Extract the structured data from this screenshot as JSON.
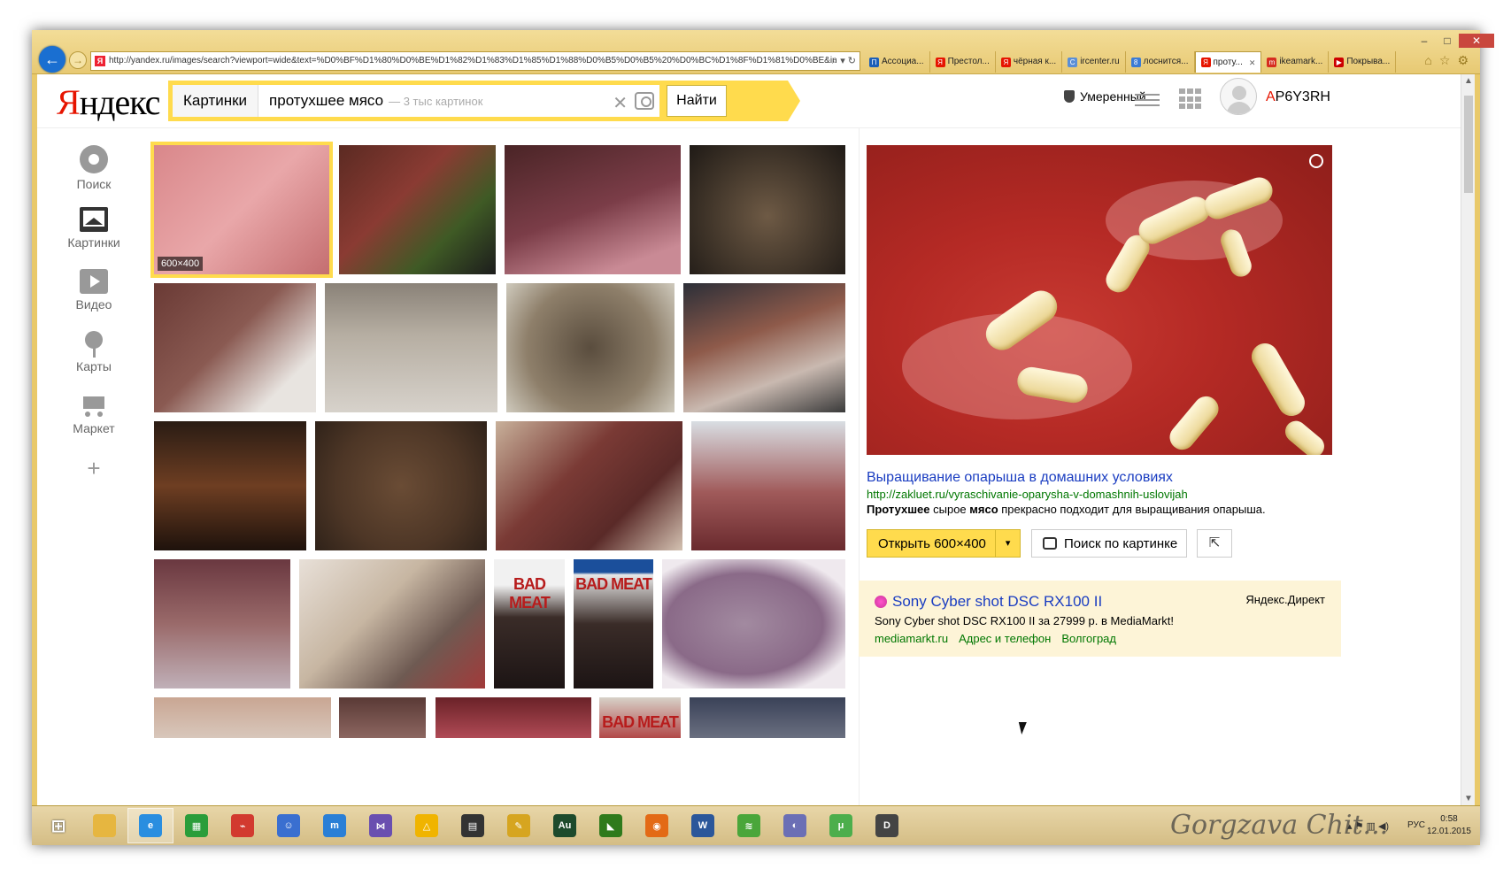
{
  "browser": {
    "address": "http://yandex.ru/images/search?viewport=wide&text=%D0%BF%D1%80%D0%BE%D1%82%D1%83%D1%85%D1%88%D0%B5%D0%B5%20%D0%BC%D1%8F%D1%81%D0%BE&in",
    "tabs": [
      {
        "label": "Ассоциа...",
        "color": "#1b5fb8",
        "glyph": "П"
      },
      {
        "label": "Престол...",
        "color": "#e61400",
        "glyph": "Я"
      },
      {
        "label": "чёрная к...",
        "color": "#e61400",
        "glyph": "Я"
      },
      {
        "label": "ircenter.ru",
        "color": "#5a8fd6",
        "glyph": "C"
      },
      {
        "label": "лоснится...",
        "color": "#3a7bd5",
        "glyph": "8"
      },
      {
        "label": "проту...",
        "color": "#e61400",
        "glyph": "Я",
        "active": true
      },
      {
        "label": "ikeamark...",
        "color": "#d62d20",
        "glyph": "m"
      },
      {
        "label": "Покрыва...",
        "color": "#cc0000",
        "glyph": "▶"
      }
    ],
    "window_buttons": {
      "minimize": "–",
      "maximize": "□",
      "close": "✕"
    }
  },
  "header": {
    "logo_first": "Я",
    "logo_rest": "ндекс",
    "search_tag": "Картинки",
    "search_query": "протухшее мясо",
    "search_count": "— 3 тыс картинок",
    "find_label": "Найти",
    "safe_search": "Умеренный",
    "username_first": "A",
    "username_rest": "P6Y3RH"
  },
  "services": [
    {
      "label": "Поиск",
      "icon": "search-icon",
      "kind": "search"
    },
    {
      "label": "Картинки",
      "icon": "picture-icon",
      "kind": "pic"
    },
    {
      "label": "Видео",
      "icon": "video-icon",
      "kind": "video"
    },
    {
      "label": "Карты",
      "icon": "map-pin-icon",
      "kind": "maps"
    },
    {
      "label": "Маркет",
      "icon": "cart-icon",
      "kind": "cart"
    }
  ],
  "selected_size": "600×400",
  "dvd_titles": [
    "BAD MEAT",
    "BAD MEAT",
    "BAD MEAT"
  ],
  "preview": {
    "title": "Выращивание опарыша в домашних условиях",
    "url": "http://zakluet.ru/vyraschivanie-oparysha-v-domashnih-uslovijah",
    "snippet_b1": "Протухшее",
    "snippet_t1": " сырое ",
    "snippet_b2": "мясо",
    "snippet_t2": " прекрасно подходит для выращивания опарыша.",
    "open_label": "Открыть 600×400",
    "reverse_label": "Поиск по картинке"
  },
  "direct": {
    "title": "Sony Cyber shot DSC RX100 II",
    "label": "Яндекс.Директ",
    "text": "Sony Cyber shot DSC RX100 II за 27999 р. в MediaMarkt!",
    "links": [
      "mediamarkt.ru",
      "Адрес и телефон",
      "Волгоград"
    ]
  },
  "taskbar": {
    "apps": [
      {
        "name": "windows-start-icon",
        "color": "#ffffff",
        "glyph": "⊞"
      },
      {
        "name": "file-explorer-icon",
        "color": "#e6b640",
        "glyph": ""
      },
      {
        "name": "internet-explorer-icon",
        "color": "#2a8ee0",
        "glyph": "e",
        "active": true
      },
      {
        "name": "store-icon",
        "color": "#2a9d3a",
        "glyph": "▦"
      },
      {
        "name": "usb-icon",
        "color": "#d23a2f",
        "glyph": "⌁"
      },
      {
        "name": "contacts-icon",
        "color": "#3a6fd0",
        "glyph": "☺"
      },
      {
        "name": "maxthon-icon",
        "color": "#2a7fd6",
        "glyph": "m"
      },
      {
        "name": "vs-icon",
        "color": "#6a4fb0",
        "glyph": "⋈"
      },
      {
        "name": "drive-icon",
        "color": "#f0b400",
        "glyph": "△"
      },
      {
        "name": "film-icon",
        "color": "#333333",
        "glyph": "▤"
      },
      {
        "name": "pen-icon",
        "color": "#d6a520",
        "glyph": "✎"
      },
      {
        "name": "audition-icon",
        "color": "#1d4a2c",
        "glyph": "Au"
      },
      {
        "name": "nvidia-icon",
        "color": "#2f7a1c",
        "glyph": "◣"
      },
      {
        "name": "firefox-icon",
        "color": "#e36a16",
        "glyph": "◉"
      },
      {
        "name": "word-icon",
        "color": "#2b579a",
        "glyph": "W"
      },
      {
        "name": "leaf-icon",
        "color": "#4aa63a",
        "glyph": "≋"
      },
      {
        "name": "browser-icon",
        "color": "#6b6fb5",
        "glyph": "◐"
      },
      {
        "name": "utorrent-icon",
        "color": "#4cae4c",
        "glyph": "μ"
      },
      {
        "name": "downloader-icon",
        "color": "#444444",
        "glyph": "D"
      }
    ],
    "signature": "Gorgzava  Chit...",
    "lang": "РУС",
    "time": "0:58",
    "date": "12.01.2015"
  }
}
